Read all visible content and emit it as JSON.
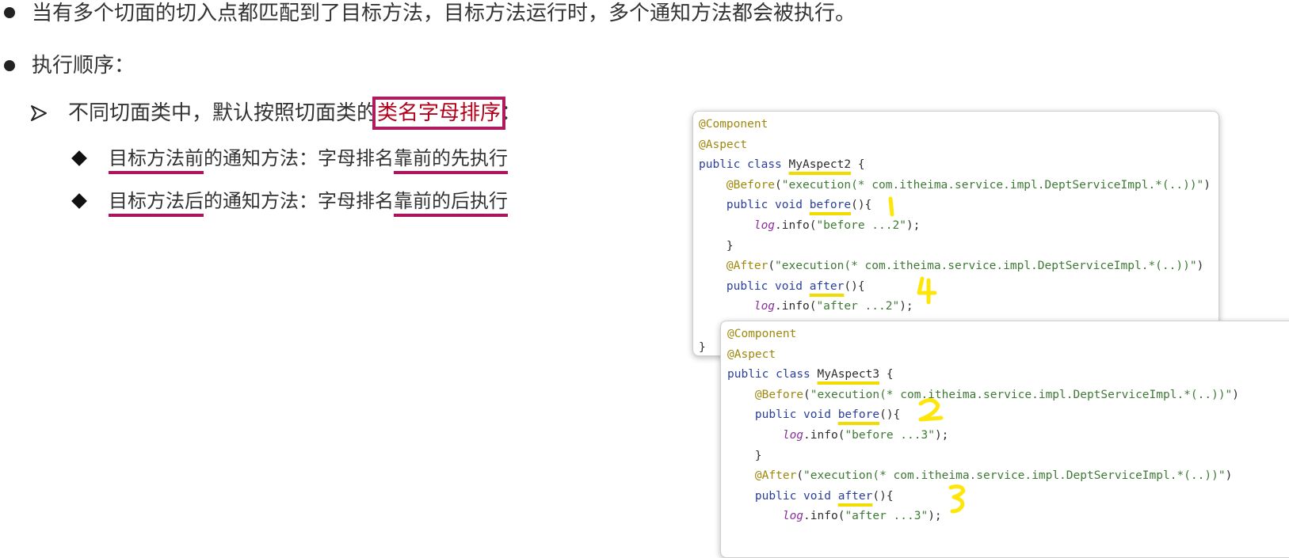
{
  "bullets": {
    "line1": "当有多个切面的切入点都匹配到了目标方法，目标方法运行时，多个通知方法都会被执行。",
    "line2": "执行顺序：",
    "sub": {
      "prefix": "不同切面类中，默认按照切面类的",
      "highlight": "类名字母排序",
      "suffix": "："
    },
    "item1": {
      "a": "目标方法前",
      "b": "的通知方法：字母排名",
      "c": "靠前的先执行"
    },
    "item2": {
      "a": "目标方法后",
      "b": "的通知方法：字母排名",
      "c": "靠前的后执行"
    }
  },
  "code1": {
    "component": "@Component",
    "aspect": "@Aspect",
    "kw_public": "public",
    "kw_class": "class",
    "class_name": "MyAspect2",
    "brace_open": " {",
    "before_ann": "@Before",
    "paren_open": "(",
    "before_expr": "\"execution(* com.itheima.service.impl.DeptServiceImpl.*(..))\"",
    "paren_close": ")",
    "kw_void": "void",
    "before_name": "before",
    "method_tail": "(){",
    "log": "log",
    "info_open": ".info(",
    "before_msg": "\"before ...2\"",
    "stmt_end": ");",
    "close_brace": "}",
    "after_ann": "@After",
    "after_expr": "\"execution(* com.itheima.service.impl.DeptServiceImpl.*(..))\"",
    "after_name": "after",
    "after_msg": "\"after ...2\"",
    "final_brace": "}"
  },
  "code2": {
    "component": "@Component",
    "aspect": "@Aspect",
    "kw_public": "public",
    "kw_class": "class",
    "class_name": "MyAspect3",
    "brace_open": " {",
    "before_ann": "@Before",
    "paren_open": "(",
    "before_expr": "\"execution(* com.itheima.service.impl.DeptServiceImpl.*(..))\"",
    "paren_close": ")",
    "kw_void": "void",
    "before_name": "before",
    "method_tail": "(){",
    "log": "log",
    "info_open": ".info(",
    "before_msg": "\"before ...3\"",
    "stmt_end": ");",
    "close_brace": "}",
    "after_ann": "@After",
    "after_expr": "\"execution(* com.itheima.service.impl.DeptServiceImpl.*(..))\"",
    "after_name": "after",
    "after_msg": "\"after ...3\""
  },
  "annotations": {
    "numbers": [
      "1",
      "4",
      "2",
      "3"
    ],
    "color": "#ffe60a"
  },
  "colors": {
    "highlight_text": "#b3001b",
    "box_border": "#b01a5e",
    "underline": "#b0135e",
    "code_underline": "#f1dc00"
  }
}
